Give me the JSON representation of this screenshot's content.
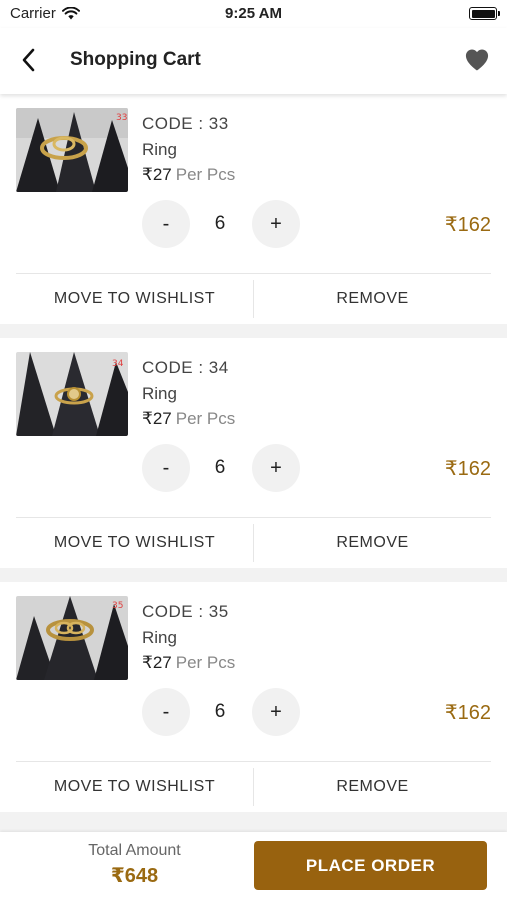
{
  "status_bar": {
    "carrier": "Carrier",
    "time": "9:25 AM"
  },
  "header": {
    "title": "Shopping Cart"
  },
  "items": [
    {
      "code": "CODE : 33",
      "name": "Ring",
      "price": "₹27",
      "unit": "Per Pcs",
      "quantity": "6",
      "total": "₹162",
      "tag": "33",
      "minus": "-",
      "plus": "+",
      "wishlist": "MOVE TO WISHLIST",
      "remove": "REMOVE"
    },
    {
      "code": "CODE : 34",
      "name": "Ring",
      "price": "₹27",
      "unit": "Per Pcs",
      "quantity": "6",
      "total": "₹162",
      "tag": "34",
      "minus": "-",
      "plus": "+",
      "wishlist": "MOVE TO WISHLIST",
      "remove": "REMOVE"
    },
    {
      "code": "CODE : 35",
      "name": "Ring",
      "price": "₹27",
      "unit": "Per Pcs",
      "quantity": "6",
      "total": "₹162",
      "tag": "35",
      "minus": "-",
      "plus": "+",
      "wishlist": "MOVE TO WISHLIST",
      "remove": "REMOVE"
    }
  ],
  "footer": {
    "total_label": "Total Amount",
    "total_value": "₹648",
    "place_order": "PLACE ORDER"
  },
  "colors": {
    "accent": "#98620f",
    "price": "#9a6a12"
  },
  "icons": {
    "back": "chevron-left-icon",
    "wishlist": "heart-icon",
    "signal": "wifi-icon",
    "battery": "battery-icon"
  }
}
